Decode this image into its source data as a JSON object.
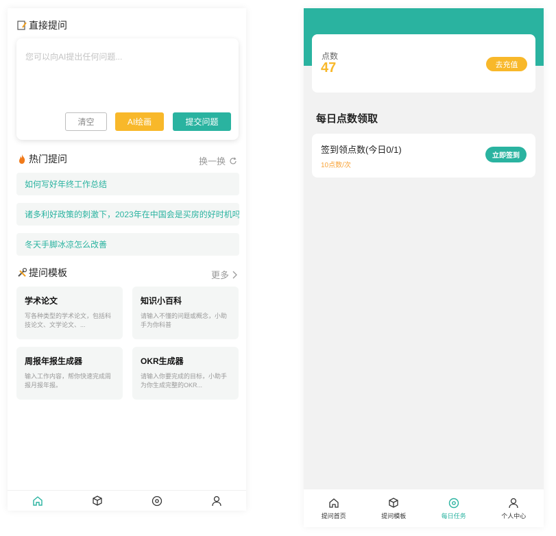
{
  "colors": {
    "accent": "#2ab3a0",
    "warning": "#f8b82a",
    "points_sub": "#f8a43a"
  },
  "left": {
    "ask_section": {
      "title": "直接提问",
      "icon": "note-icon"
    },
    "ask": {
      "placeholder": "您可以向AI提出任何问题...",
      "clear_label": "清空",
      "draw_label": "AI绘画",
      "submit_label": "提交问题"
    },
    "hot": {
      "title": "热门提问",
      "icon": "fire-icon",
      "refresh_label": "换一换",
      "items": [
        "如何写好年终工作总结",
        "诸多利好政策的刺激下，2023年在中国会是买房的好时机吗",
        "冬天手脚冰凉怎么改善"
      ]
    },
    "templates": {
      "title": "提问模板",
      "icon": "tools-icon",
      "more_label": "更多",
      "cards": [
        {
          "title": "学术论文",
          "desc": "写各种类型的学术论文，包括科技论文、文学论文、..."
        },
        {
          "title": "知识小百科",
          "desc": "请输入不懂的问题或概念，小助手为你科普"
        },
        {
          "title": "周报年报生成器",
          "desc": "输入工作内容，帮你快速完成周报月报年报。"
        },
        {
          "title": "OKR生成器",
          "desc": "请输入你要完成的目标，小助手为你生成完整的OKR..."
        }
      ]
    },
    "tabbar": [
      "home-icon",
      "cube-icon",
      "target-icon",
      "user-icon"
    ]
  },
  "right": {
    "points": {
      "label": "点数",
      "value": "47",
      "recharge_label": "去充值"
    },
    "daily": {
      "title": "每日点数领取"
    },
    "task": {
      "name": "签到领点数(今日0/1)",
      "sub": "10点数/次",
      "button": "立即签到"
    },
    "tabbar": [
      {
        "label": "提问首页",
        "icon": "home-icon"
      },
      {
        "label": "提问模板",
        "icon": "cube-icon"
      },
      {
        "label": "每日任务",
        "icon": "target-icon",
        "active": true
      },
      {
        "label": "个人中心",
        "icon": "user-icon"
      }
    ]
  }
}
